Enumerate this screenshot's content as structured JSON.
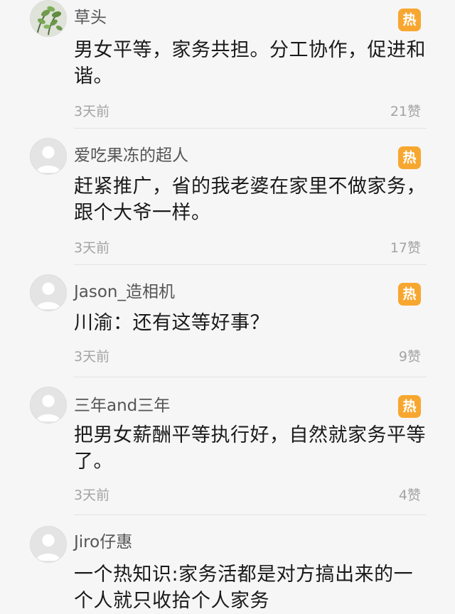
{
  "comments": [
    {
      "username": "草头",
      "avatar_icon": "plant-photo-avatar",
      "hot_label": "热",
      "text": "男女平等，家务共担。分工协作，促进和谐。",
      "time": "3天前",
      "likes": "21赞"
    },
    {
      "username": "爱吃果冻的超人",
      "avatar_icon": "default-user-avatar",
      "hot_label": "热",
      "text": "赶紧推广，省的我老婆在家里不做家务，跟个大爷一样。",
      "time": "3天前",
      "likes": "17赞"
    },
    {
      "username": "Jason_造相机",
      "avatar_icon": "default-user-avatar",
      "hot_label": "热",
      "text": "川渝：还有这等好事？",
      "time": "3天前",
      "likes": "9赞"
    },
    {
      "username": "三年and三年",
      "avatar_icon": "default-user-avatar",
      "hot_label": "热",
      "text": "把男女薪酬平等执行好，自然就家务平等了。",
      "time": "3天前",
      "likes": "4赞"
    },
    {
      "username": "Jiro仔惠",
      "avatar_icon": "default-user-avatar",
      "text": "一个热知识:家务活都是对方搞出来的一个人就只收拾个人家务"
    }
  ],
  "colors": {
    "hot_badge": "#f7a730",
    "username": "#555555",
    "text": "#1a1a1a",
    "meta": "#a3a3a3",
    "background": "#f6f6f6"
  }
}
